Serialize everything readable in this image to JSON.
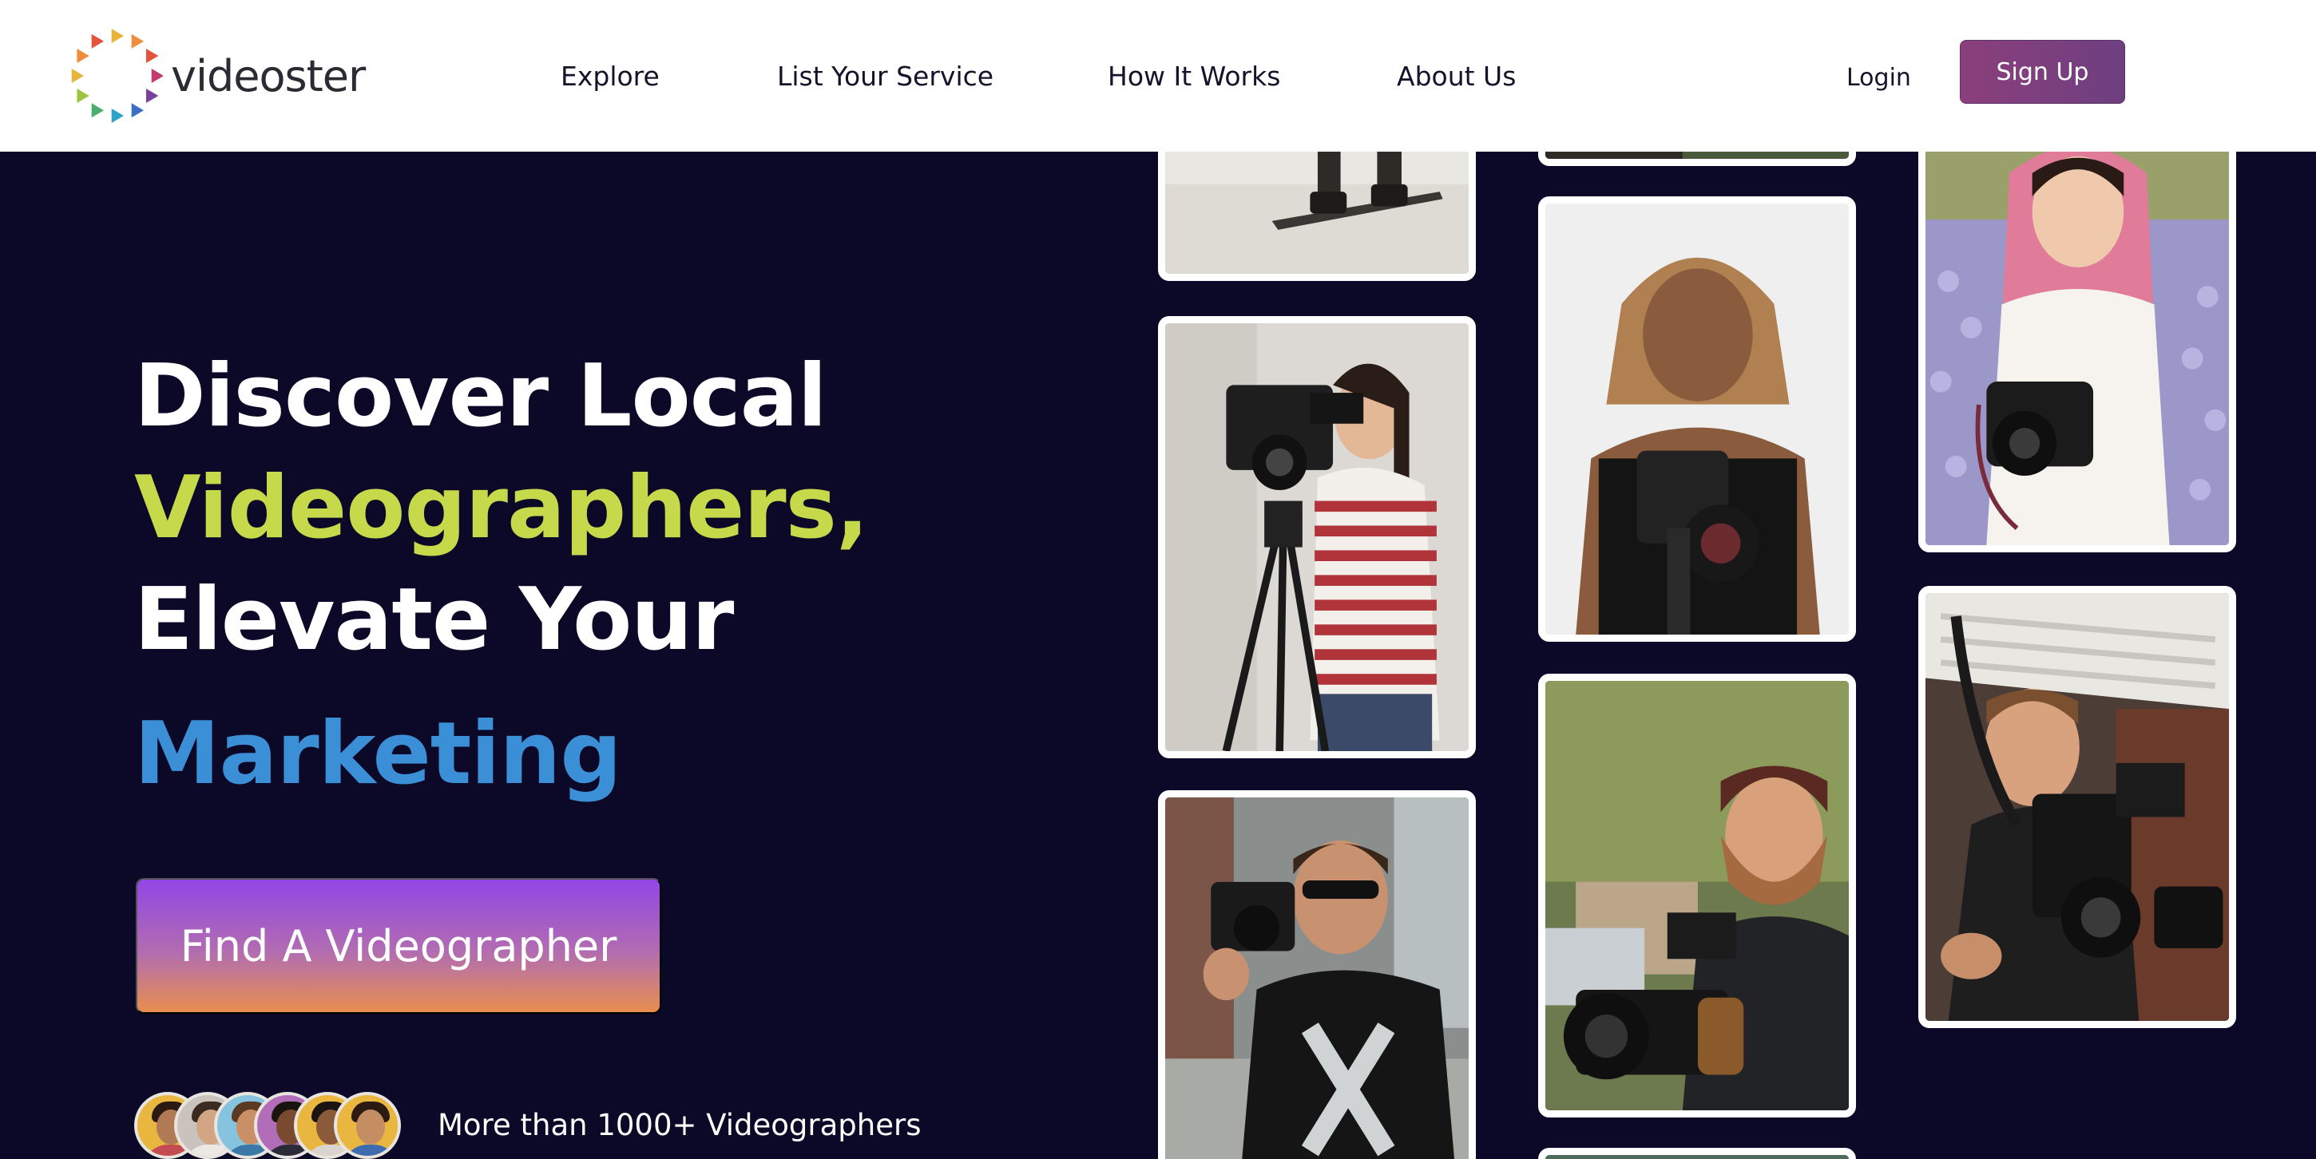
{
  "brand": {
    "name": "videoster",
    "logo_colors": [
      "#e8b53c",
      "#f08c3a",
      "#e5533d",
      "#c23c6e",
      "#7a3f9a",
      "#3b6fc4",
      "#2fa3c7",
      "#4cae6e",
      "#9cc43e"
    ]
  },
  "nav": {
    "items": [
      {
        "label": "Explore"
      },
      {
        "label": "List Your Service"
      },
      {
        "label": "How It Works"
      },
      {
        "label": "About Us"
      }
    ],
    "login_label": "Login",
    "signup_label": "Sign Up"
  },
  "hero": {
    "line1": "Discover Local",
    "line2": "Videographers,",
    "line3": "Elevate Your",
    "line4": "Marketing",
    "colors": {
      "highlight_green": "#c5d94a",
      "highlight_blue": "#3b8fd6",
      "background": "#0c0828"
    },
    "cta_label": "Find A Videographer",
    "social_proof": "More than 1000+ Videographers"
  },
  "photos": [
    {
      "subject": "snowboarder-photo"
    },
    {
      "subject": "woman-with-video-camera-photo"
    },
    {
      "subject": "man-with-camera-sunglasses-photo"
    },
    {
      "subject": "woman-with-gimbal-photo"
    },
    {
      "subject": "man-with-cinema-camera-photo"
    },
    {
      "subject": "woman-with-camera-flowers-photo"
    },
    {
      "subject": "man-with-camera-rig-photo"
    }
  ],
  "icons": {
    "logo": "play-triangles-ring-icon"
  }
}
